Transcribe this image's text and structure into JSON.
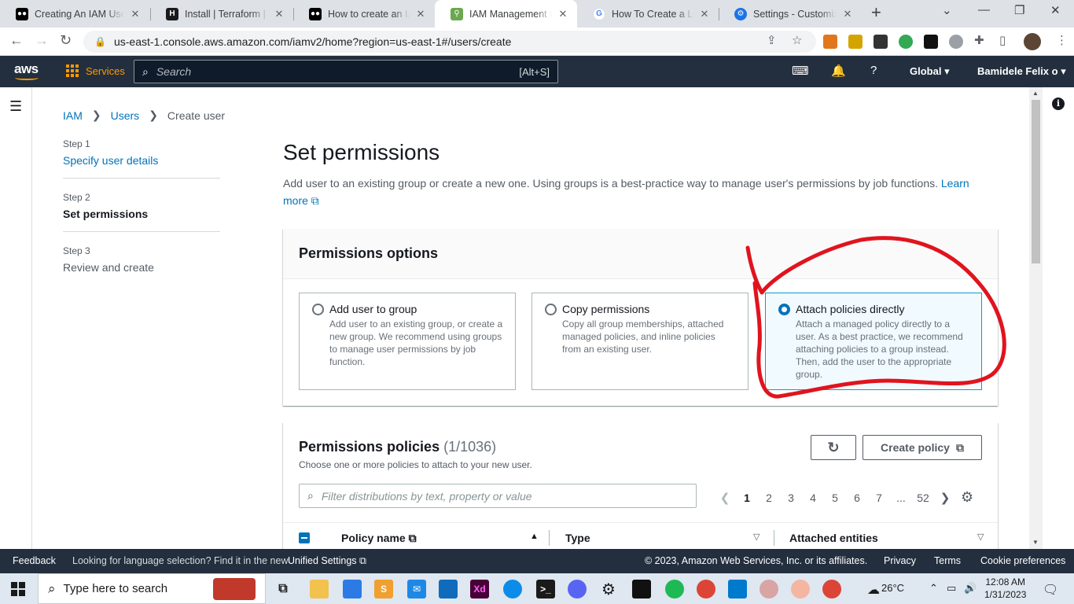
{
  "browser": {
    "tabs": [
      {
        "label": "Creating An IAM User",
        "favicon": "medium-icon",
        "color": "#000000"
      },
      {
        "label": "Install | Terraform | Hashi",
        "favicon": "terraform-icon",
        "color": "#1a1a1a"
      },
      {
        "label": "How to create an IAM",
        "favicon": "medium-icon",
        "color": "#000000"
      },
      {
        "label": "IAM Management Con",
        "favicon": "aws-icon",
        "color": "#6aa84f"
      },
      {
        "label": "How To Create a Load",
        "favicon": "google-icon",
        "color": "#4285f4"
      },
      {
        "label": "Settings - Customize",
        "favicon": "settings-gear-icon",
        "color": "#1a73e8"
      }
    ],
    "new_tab_symbol": "+",
    "url": "us-east-1.console.aws.amazon.com/iamv2/home?region=us-east-1#/users/create"
  },
  "aws_header": {
    "logo": "aws",
    "services_label": "Services",
    "search_placeholder": "Search",
    "search_shortcut": "[Alt+S]",
    "region": "Global",
    "account": "Bamidele Felix o"
  },
  "breadcrumb": {
    "items": [
      "IAM",
      "Users"
    ],
    "current": "Create user"
  },
  "steps": [
    {
      "num": "Step 1",
      "title": "Specify user details",
      "state": "link"
    },
    {
      "num": "Step 2",
      "title": "Set permissions",
      "state": "active"
    },
    {
      "num": "Step 3",
      "title": "Review and create",
      "state": "disabled"
    }
  ],
  "page": {
    "title": "Set permissions",
    "description": "Add user to an existing group or create a new one. Using groups is a best-practice way to manage user's permissions by job functions.",
    "learn_more": "Learn more"
  },
  "permissions_options": {
    "title": "Permissions options",
    "options": [
      {
        "title": "Add user to group",
        "description": "Add user to an existing group, or create a new group. We recommend using groups to manage user permissions by job function.",
        "selected": false
      },
      {
        "title": "Copy permissions",
        "description": "Copy all group memberships, attached managed policies, and inline policies from an existing user.",
        "selected": false
      },
      {
        "title": "Attach policies directly",
        "description": "Attach a managed policy directly to a user. As a best practice, we recommend attaching policies to a group instead. Then, add the user to the appropriate group.",
        "selected": true
      }
    ]
  },
  "permissions_policies": {
    "title": "Permissions policies",
    "count": "(1/1036)",
    "subtitle": "Choose one or more policies to attach to your new user.",
    "refresh_icon": "refresh-icon",
    "create_policy_label": "Create policy",
    "filter_placeholder": "Filter distributions by text, property or value",
    "pages": [
      "1",
      "2",
      "3",
      "4",
      "5",
      "6",
      "7",
      "...",
      "52"
    ],
    "current_page": "1",
    "columns": [
      "Policy name",
      "Type",
      "Attached entities"
    ]
  },
  "footer": {
    "feedback": "Feedback",
    "language_prompt": "Looking for language selection? Find it in the new",
    "unified_settings": "Unified Settings",
    "copyright": "© 2023, Amazon Web Services, Inc. or its affiliates.",
    "privacy": "Privacy",
    "terms": "Terms",
    "cookie": "Cookie preferences"
  },
  "taskbar": {
    "search_placeholder": "Type here to search",
    "weather": "26°C",
    "time": "12:08 AM",
    "date": "1/31/2023"
  },
  "colors": {
    "aws_navy": "#232f3e",
    "aws_orange": "#ff9900",
    "link_blue": "#0073bb",
    "selected_tile_bg": "#f1faff",
    "annotation_red": "#e0141e"
  }
}
